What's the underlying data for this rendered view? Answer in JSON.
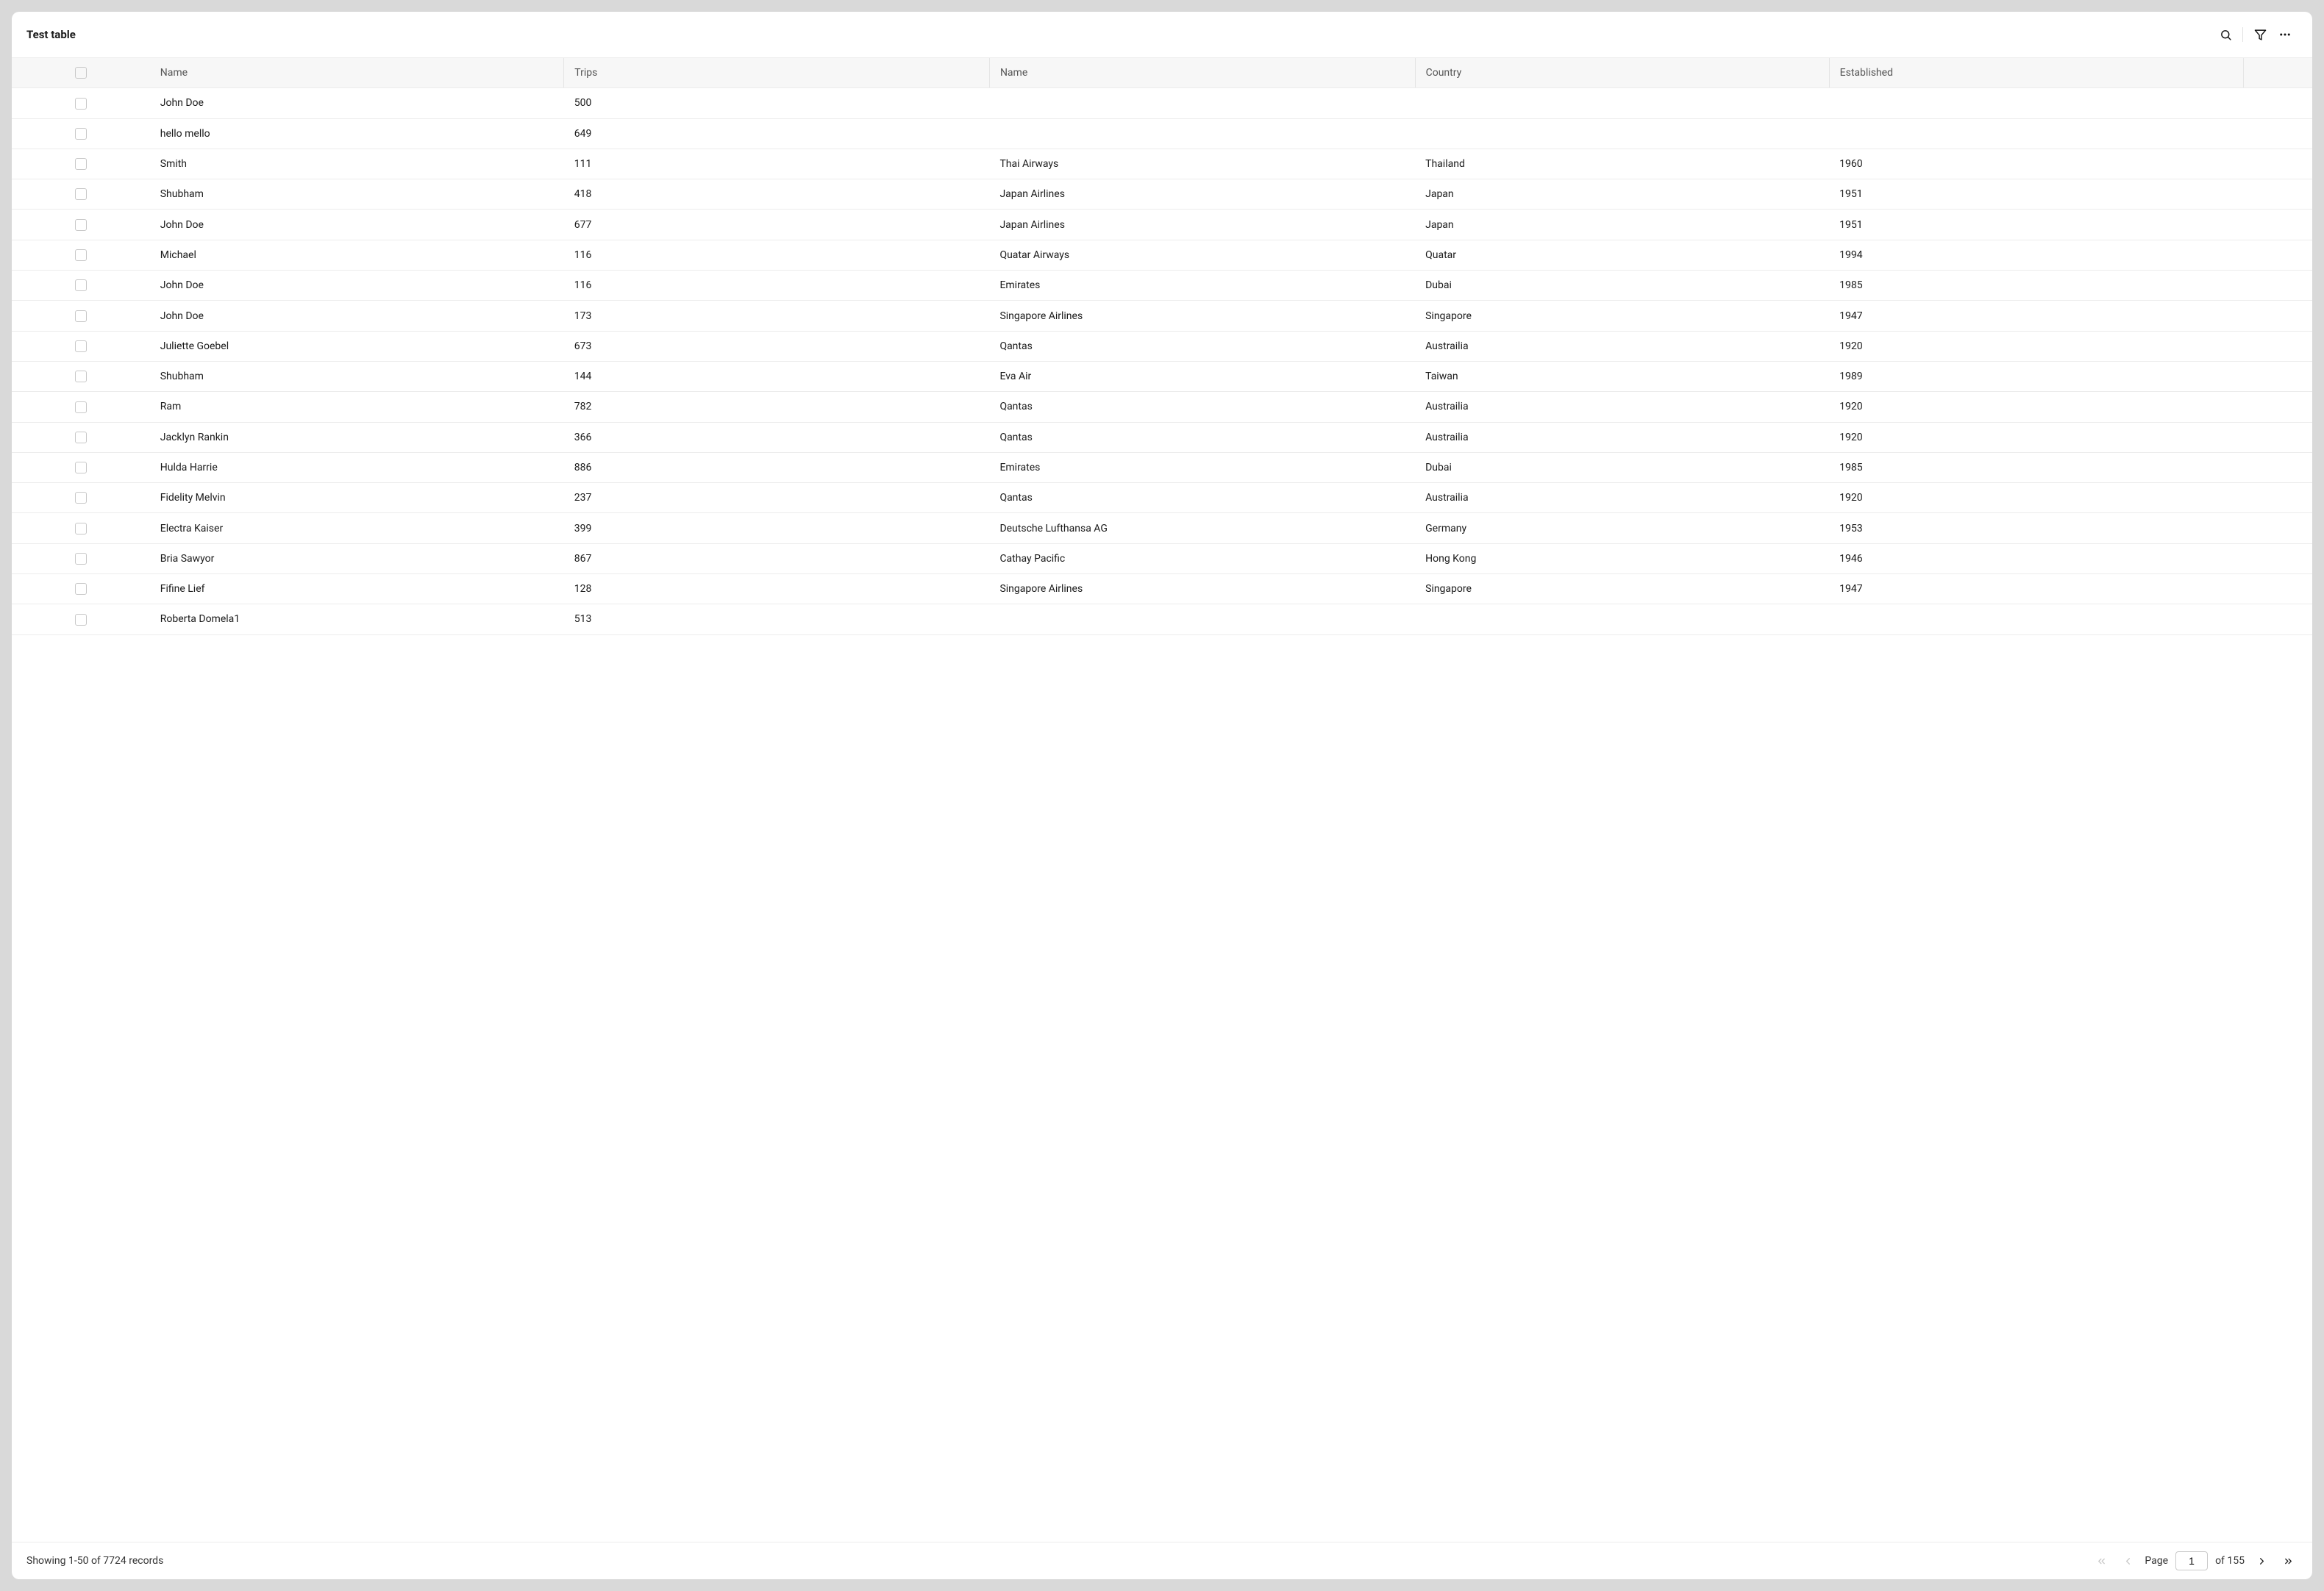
{
  "title": "Test table",
  "columns": [
    "Name",
    "Trips",
    "Name",
    "Country",
    "Established"
  ],
  "rows": [
    {
      "name": "John Doe",
      "trips": "500",
      "airline": "",
      "country": "",
      "established": ""
    },
    {
      "name": "hello mello",
      "trips": "649",
      "airline": "",
      "country": "",
      "established": ""
    },
    {
      "name": "Smith",
      "trips": "111",
      "airline": "Thai Airways",
      "country": "Thailand",
      "established": "1960"
    },
    {
      "name": "Shubham",
      "trips": "418",
      "airline": "Japan Airlines",
      "country": "Japan",
      "established": "1951"
    },
    {
      "name": "John Doe",
      "trips": "677",
      "airline": "Japan Airlines",
      "country": "Japan",
      "established": "1951"
    },
    {
      "name": "Michael",
      "trips": "116",
      "airline": "Quatar Airways",
      "country": "Quatar",
      "established": "1994"
    },
    {
      "name": "John Doe",
      "trips": "116",
      "airline": "Emirates",
      "country": "Dubai",
      "established": "1985"
    },
    {
      "name": "John Doe",
      "trips": "173",
      "airline": "Singapore Airlines",
      "country": "Singapore",
      "established": "1947"
    },
    {
      "name": "Juliette Goebel",
      "trips": "673",
      "airline": "Qantas",
      "country": "Austrailia",
      "established": "1920"
    },
    {
      "name": "Shubham",
      "trips": "144",
      "airline": "Eva Air",
      "country": "Taiwan",
      "established": "1989"
    },
    {
      "name": "Ram",
      "trips": "782",
      "airline": "Qantas",
      "country": "Austrailia",
      "established": "1920"
    },
    {
      "name": "Jacklyn Rankin",
      "trips": "366",
      "airline": "Qantas",
      "country": "Austrailia",
      "established": "1920"
    },
    {
      "name": "Hulda Harrie",
      "trips": "886",
      "airline": "Emirates",
      "country": "Dubai",
      "established": "1985"
    },
    {
      "name": "Fidelity Melvin",
      "trips": "237",
      "airline": "Qantas",
      "country": "Austrailia",
      "established": "1920"
    },
    {
      "name": "Electra Kaiser",
      "trips": "399",
      "airline": "Deutsche Lufthansa AG",
      "country": "Germany",
      "established": "1953"
    },
    {
      "name": "Bria Sawyor",
      "trips": "867",
      "airline": "Cathay Pacific",
      "country": "Hong Kong",
      "established": "1946"
    },
    {
      "name": "Fifine Lief",
      "trips": "128",
      "airline": "Singapore Airlines",
      "country": "Singapore",
      "established": "1947"
    },
    {
      "name": "Roberta Domela1",
      "trips": "513",
      "airline": "",
      "country": "",
      "established": ""
    }
  ],
  "footer": {
    "status": "Showing 1-50 of 7724 records",
    "page_label": "Page",
    "current_page": "1",
    "of_label": "of 155"
  }
}
